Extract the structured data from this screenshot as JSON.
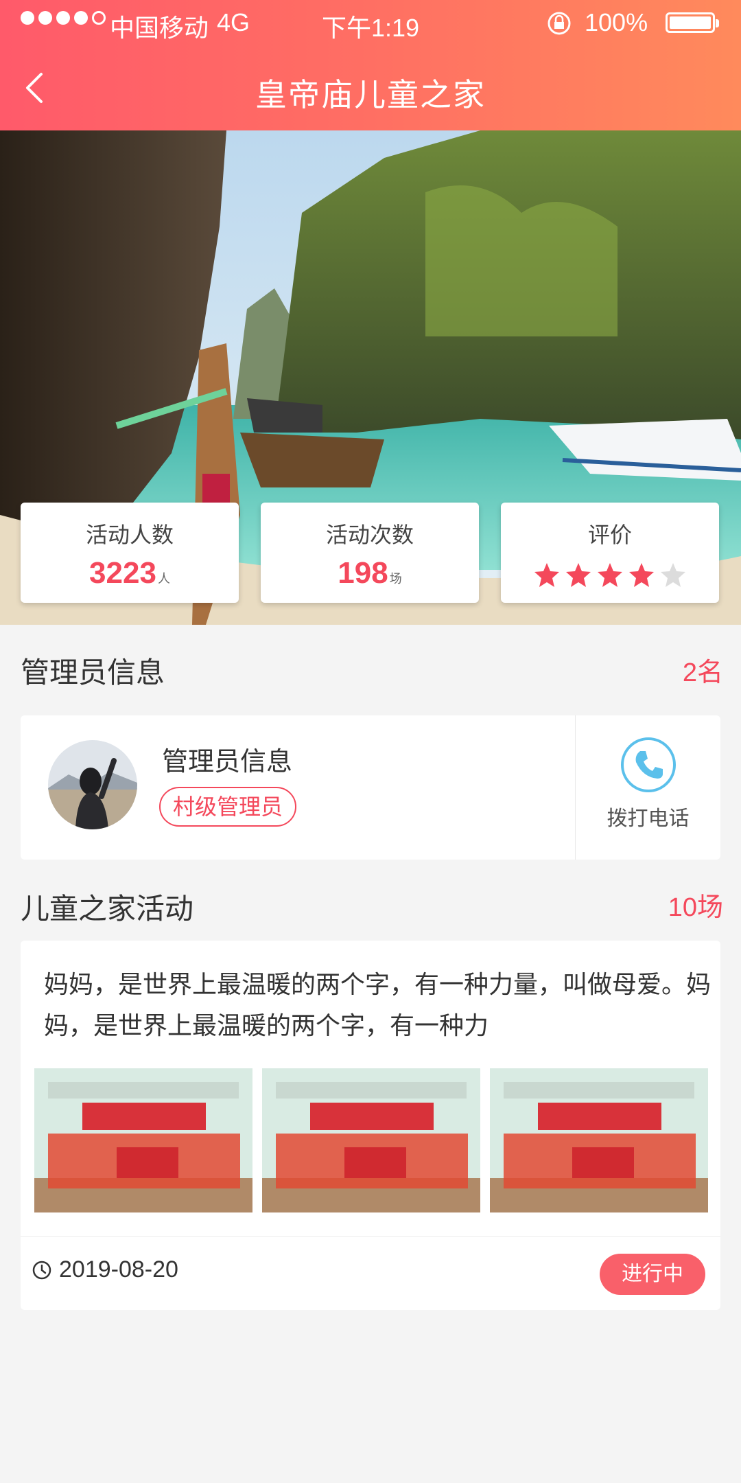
{
  "status_bar": {
    "carrier": "中国移动",
    "network": "4G",
    "time": "下午1:19",
    "battery": "100%"
  },
  "nav": {
    "title": "皇帝庙儿童之家"
  },
  "stats": [
    {
      "label": "活动人数",
      "value": "3223",
      "unit": "人"
    },
    {
      "label": "活动次数",
      "value": "198",
      "unit": "场"
    },
    {
      "label": "评价",
      "rating": 4,
      "max": 5
    }
  ],
  "admin_section": {
    "title": "管理员信息",
    "count": "2名",
    "card": {
      "name": "管理员信息",
      "tag": "村级管理员",
      "call_label": "拨打电话"
    }
  },
  "activity_section": {
    "title": "儿童之家活动",
    "count": "10场",
    "card": {
      "text": "妈妈，是世界上最温暖的两个字，有一种力量，叫做母爱。妈妈，是世界上最温暖的两个字，有一种力",
      "date": "2019-08-20",
      "status": "进行中"
    }
  },
  "colors": {
    "accent": "#f4485b",
    "header_start": "#ff5a6a",
    "header_end": "#ff8a5c",
    "call_icon": "#5bc0eb"
  }
}
